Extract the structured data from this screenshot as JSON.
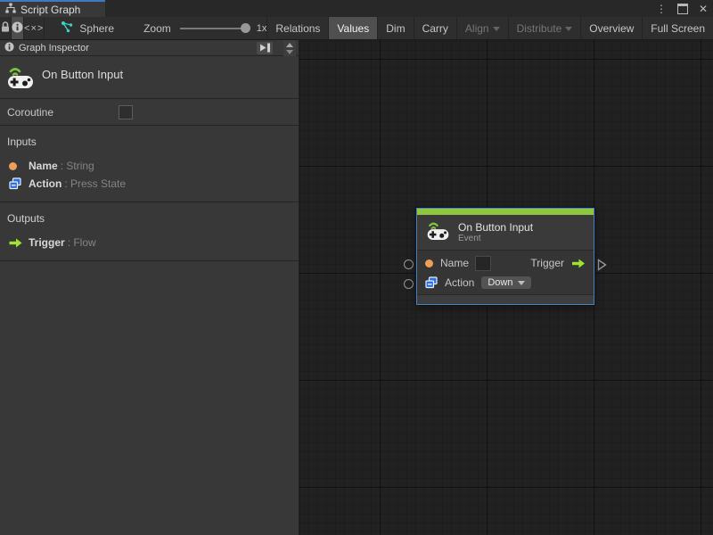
{
  "tab": {
    "label": "Script Graph"
  },
  "window_controls": {
    "menu_glyph": "⋮",
    "close_glyph": "✕"
  },
  "toolbar": {
    "code_glyph": "<×>",
    "sphere_label": "Sphere",
    "zoom_label": "Zoom",
    "zoom_value": "1x",
    "buttons": [
      {
        "label": "Relations",
        "state": "normal"
      },
      {
        "label": "Values",
        "state": "selected"
      },
      {
        "label": "Dim",
        "state": "normal"
      },
      {
        "label": "Carry",
        "state": "normal"
      },
      {
        "label": "Align",
        "state": "disabled",
        "dropdown": true
      },
      {
        "label": "Distribute",
        "state": "disabled",
        "dropdown": true
      },
      {
        "label": "Overview",
        "state": "normal"
      },
      {
        "label": "Full Screen",
        "state": "normal"
      }
    ]
  },
  "inspector": {
    "header": "Graph Inspector",
    "unit_title": "On Button Input",
    "coroutine_label": "Coroutine",
    "coroutine_checked": false,
    "inputs_header": "Inputs",
    "inputs": [
      {
        "name": "Name",
        "type_label": ": String",
        "icon": "string-port-icon"
      },
      {
        "name": "Action",
        "type_label": ": Press State",
        "icon": "enum-port-icon"
      }
    ],
    "outputs_header": "Outputs",
    "outputs": [
      {
        "name": "Trigger",
        "type_label": ": Flow",
        "icon": "flow-port-icon"
      }
    ]
  },
  "node": {
    "title": "On Button Input",
    "subtitle": "Event",
    "name_port_label": "Name",
    "name_value": "",
    "trigger_port_label": "Trigger",
    "action_port_label": "Action",
    "action_value": "Down"
  },
  "colors": {
    "tab_focus_blue": "#4178be",
    "selection_blue": "#4384c8",
    "event_green": "#8dc73f",
    "flow_green": "#9ee32f",
    "port_orange": "#ed9e57",
    "enum_blue": "#2f6fe0",
    "graph_teal": "#3ecfc0"
  }
}
